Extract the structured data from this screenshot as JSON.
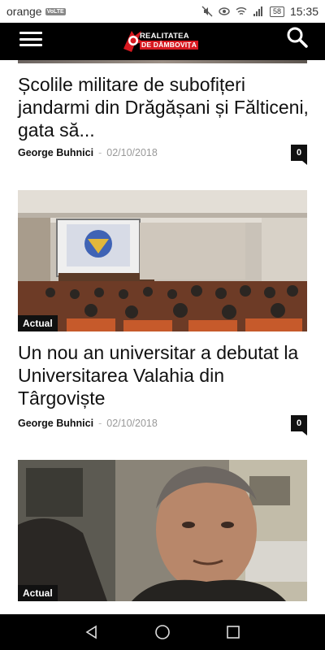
{
  "status_bar": {
    "carrier": "orange",
    "network_badge": "VoLTE",
    "battery": "58",
    "time": "15:35"
  },
  "header": {
    "logo_line1": "REALITATEA",
    "logo_line2": "DE DÂMBOVIȚA",
    "menu_icon": "hamburger-icon",
    "search_icon": "search-icon"
  },
  "articles": [
    {
      "title": "Școlile militare de subofițeri jandarmi din Drăgășani și Fălticeni, gata să...",
      "author": "George Buhnici",
      "date": "02/10/2018",
      "comments": "0"
    },
    {
      "category": "Actual",
      "title": "Un nou an universitar a debutat la Universitarea Valahia din Târgoviște",
      "author": "George Buhnici",
      "date": "02/10/2018",
      "comments": "0"
    },
    {
      "category": "Actual"
    }
  ],
  "colors": {
    "brand_red": "#d71920",
    "header_bg": "#000000"
  }
}
